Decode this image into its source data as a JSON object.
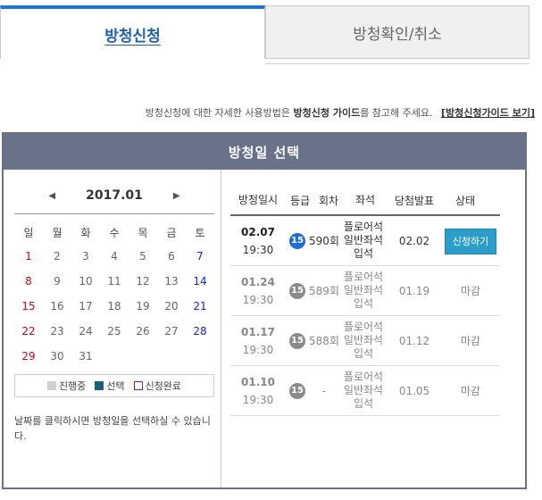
{
  "tabs": [
    {
      "label": "방청신청"
    },
    {
      "label": "방청확인/취소"
    }
  ],
  "guide": {
    "prefix": "방청신청에 대한 자세한 사용방법은 ",
    "bold": "방청신청 가이드",
    "suffix": "를 참고해 주세요.",
    "link": "[방청신청가이드 보기]"
  },
  "panel": {
    "title": "방청일 선택"
  },
  "calendar": {
    "month": "2017.01",
    "prev_icon": "triangle-left",
    "next_icon": "triangle-right",
    "weekdays": [
      "일",
      "월",
      "화",
      "수",
      "목",
      "금",
      "토"
    ],
    "weeks": [
      [
        "1",
        "2",
        "3",
        "4",
        "5",
        "6",
        "7"
      ],
      [
        "8",
        "9",
        "10",
        "11",
        "12",
        "13",
        "14"
      ],
      [
        "15",
        "16",
        "17",
        "18",
        "19",
        "20",
        "21"
      ],
      [
        "22",
        "23",
        "24",
        "25",
        "26",
        "27",
        "28"
      ],
      [
        "29",
        "30",
        "31",
        "",
        "",
        "",
        ""
      ]
    ],
    "legend": {
      "in_progress": "진행중",
      "selected": "선택",
      "applied": "신청완료"
    },
    "note": "날짜를 클릭하시면 방청일을 선택하실 수 있습니다.",
    "colors": {
      "sunday": "#d0021b",
      "saturday": "#1525c9"
    }
  },
  "table": {
    "headers": [
      "방청일시",
      "등급",
      "회차",
      "좌석",
      "당첨발표",
      "상태"
    ],
    "rows": [
      {
        "date": "02.07",
        "time": "19:30",
        "grade": "15",
        "episode": "590회",
        "seat": [
          "플로어석",
          "일반좌석",
          "입석"
        ],
        "announce": "02.02",
        "status": "신청하기"
      },
      {
        "date": "01.24",
        "time": "19:30",
        "grade": "15",
        "episode": "589회",
        "seat": [
          "플로어석",
          "일반좌석",
          "입석"
        ],
        "announce": "01.19",
        "status": "마감"
      },
      {
        "date": "01.17",
        "time": "19:30",
        "grade": "15",
        "episode": "588회",
        "seat": [
          "플로어석",
          "일반좌석",
          "입석"
        ],
        "announce": "01.12",
        "status": "마감"
      },
      {
        "date": "01.10",
        "time": "19:30",
        "grade": "15",
        "episode": "-",
        "seat": [
          "플로어석",
          "일반좌석",
          "입석"
        ],
        "announce": "01.05",
        "status": "마감"
      }
    ]
  }
}
